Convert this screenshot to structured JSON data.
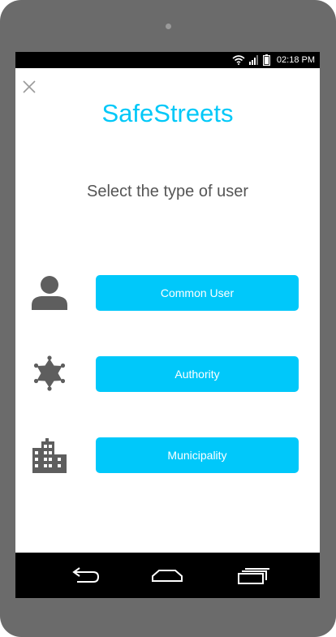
{
  "status_bar": {
    "time": "02:18 PM",
    "icons": [
      "wifi-icon",
      "signal-icon",
      "battery-icon"
    ]
  },
  "header": {
    "close_icon": "close-icon",
    "app_title": "SafeStreets",
    "subtitle": "Select the type of user"
  },
  "user_types": [
    {
      "label": "Common User",
      "icon": "person-icon"
    },
    {
      "label": "Authority",
      "icon": "sheriff-star-icon"
    },
    {
      "label": "Municipality",
      "icon": "city-building-icon"
    }
  ],
  "nav_bar": {
    "icons": [
      "back-icon",
      "home-icon",
      "recent-apps-icon"
    ]
  },
  "colors": {
    "accent": "#00c8fa",
    "icon_gray": "#5e5e5e",
    "device_frame": "#6b6b6b"
  }
}
